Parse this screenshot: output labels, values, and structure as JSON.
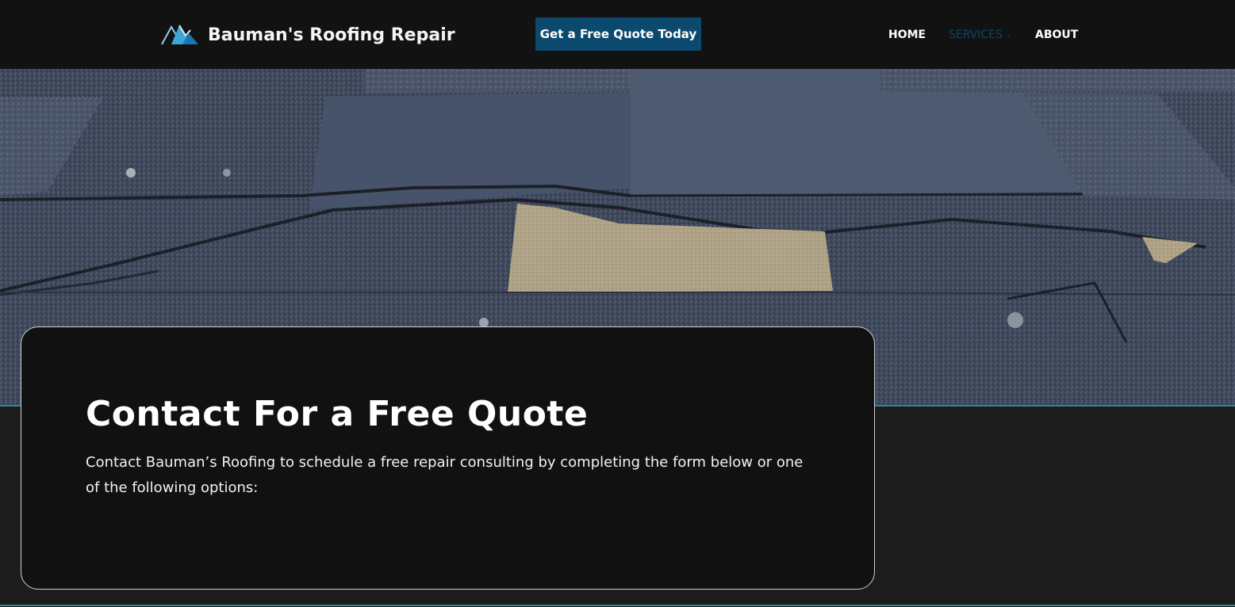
{
  "header": {
    "brand_name": "Bauman's Roofing Repair",
    "quote_button": "Get a Free Quote Today",
    "nav": {
      "home": "HOME",
      "services": "SERVICES",
      "about": "ABOUT"
    }
  },
  "hero": {
    "image_icon": "roof-shingles-photo"
  },
  "contact": {
    "title": "Contact For a Free Quote",
    "text": "Contact Bauman’s Roofing to schedule a free repair consulting by completing the form below or one of the following options:"
  },
  "colors": {
    "header_bg": "#121212",
    "button_bg": "#0b4a6e",
    "accent_line": "#1f8fa5",
    "nav_active": "#0f4563",
    "card_bg": "#111111",
    "page_bg": "#1c1c1c"
  }
}
